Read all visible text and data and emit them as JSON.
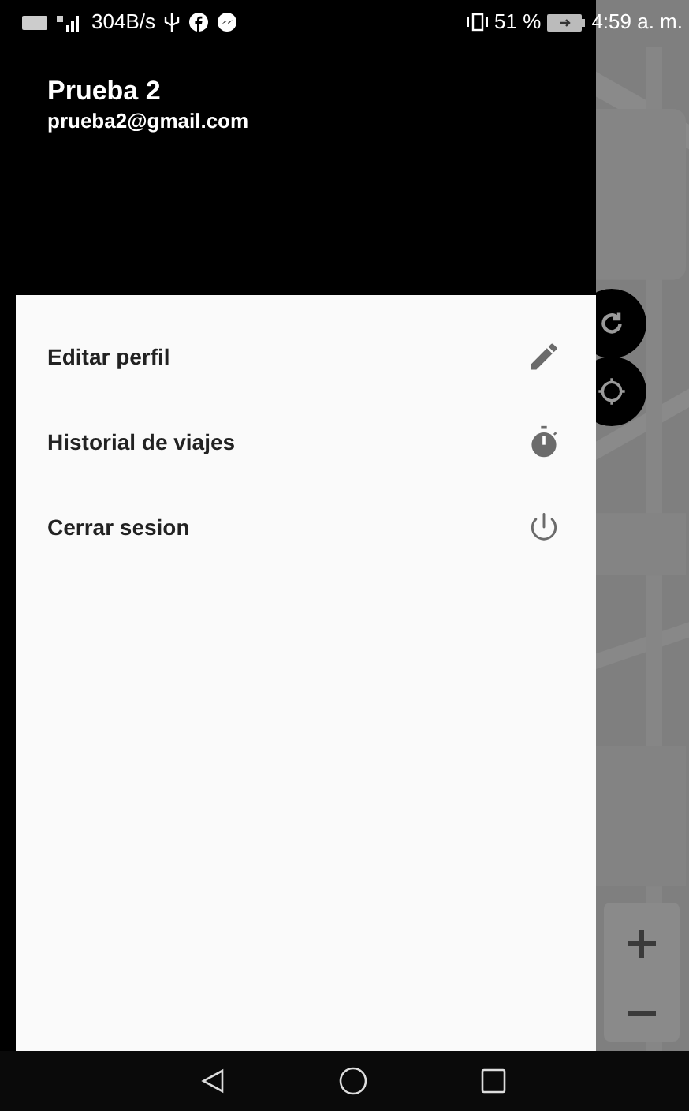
{
  "status_bar": {
    "network_speed": "304B/s",
    "battery": "51 %",
    "time": "4:59 a. m."
  },
  "header": {
    "name": "Prueba 2",
    "email": "prueba2@gmail.com"
  },
  "menu": [
    {
      "label": "Editar perfil",
      "kind": "edit"
    },
    {
      "label": "Historial de viajes",
      "kind": "history"
    },
    {
      "label": "Cerrar sesion",
      "kind": "logout"
    }
  ]
}
